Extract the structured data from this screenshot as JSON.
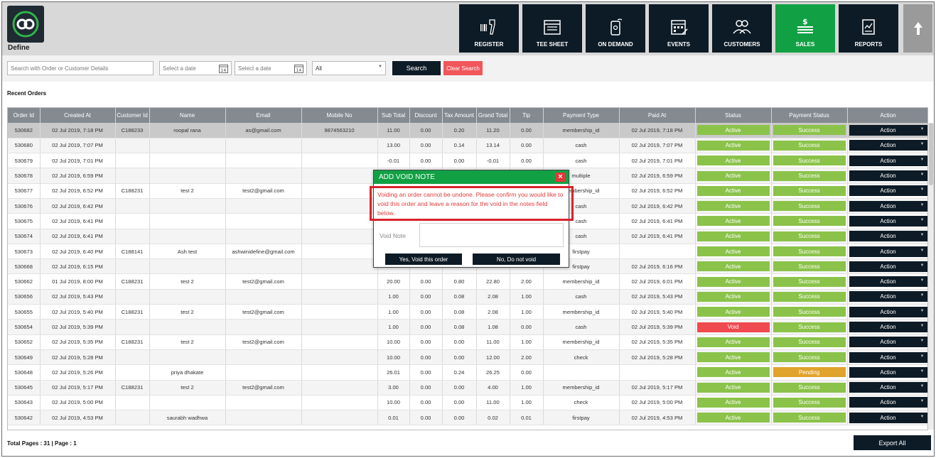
{
  "logo": {
    "text": "Define"
  },
  "nav": [
    {
      "label": "REGISTER",
      "icon": "barcode-scanner-icon"
    },
    {
      "label": "TEE SHEET",
      "icon": "calendar-list-icon"
    },
    {
      "label": "ON DEMAND",
      "icon": "mobile-phone-icon"
    },
    {
      "label": "EVENTS",
      "icon": "event-calendar-icon"
    },
    {
      "label": "CUSTOMERS",
      "icon": "people-icon"
    },
    {
      "label": "SALES",
      "icon": "money-icon"
    },
    {
      "label": "REPORTS",
      "icon": "report-icon"
    }
  ],
  "accent_green": "#11a144",
  "filters": {
    "search_placeholder": "Search with Order or Customer Details",
    "date_from_placeholder": "Select a date",
    "date_to_placeholder": "Select a date",
    "calendar_day": "14",
    "type_selected": "All",
    "search_label": "Search",
    "clear_label": "Clear Search"
  },
  "section_title": "Recent Orders",
  "table": {
    "columns": [
      "Order Id",
      "Created At",
      "Customer Id",
      "Name",
      "Email",
      "Mobile No",
      "Sub Total",
      "Discount",
      "Tax Amount",
      "Grand Total",
      "Tip",
      "Payment Type",
      "Paid At",
      "Status",
      "Payment Status",
      "Action"
    ],
    "rows": [
      [
        "530682",
        "02 Jul 2019, 7:18 PM",
        "C188233",
        "roopal rana",
        "as@gmail.com",
        "9874563210",
        "11.00",
        "0.00",
        "0.20",
        "11.20",
        "0.00",
        "membership_id",
        "02 Jul 2019, 7:18 PM",
        "Active",
        "Success",
        "Action"
      ],
      [
        "530680",
        "02 Jul 2019, 7:07 PM",
        "",
        "",
        "",
        "",
        "13.00",
        "0.00",
        "0.14",
        "13.14",
        "0.00",
        "cash",
        "02 Jul 2019, 7:07 PM",
        "Active",
        "Success",
        "Action"
      ],
      [
        "530679",
        "02 Jul 2019, 7:01 PM",
        "",
        "",
        "",
        "",
        "-0.01",
        "0.00",
        "0.00",
        "-0.01",
        "0.00",
        "cash",
        "02 Jul 2019, 7:01 PM",
        "Active",
        "Success",
        "Action"
      ],
      [
        "530678",
        "02 Jul 2019, 6:59 PM",
        "",
        "",
        "",
        "",
        "",
        "",
        "",
        "",
        "",
        "multiple",
        "02 Jul 2019, 6:59 PM",
        "Active",
        "Success",
        "Action"
      ],
      [
        "530677",
        "02 Jul 2019, 6:52 PM",
        "C188231",
        "test 2",
        "test2@gmail.com",
        "",
        "",
        "",
        "",
        "",
        "",
        "membership_id",
        "02 Jul 2019, 6:52 PM",
        "Active",
        "Success",
        "Action"
      ],
      [
        "530676",
        "02 Jul 2019, 6:42 PM",
        "",
        "",
        "",
        "",
        "",
        "",
        "",
        "",
        "",
        "cash",
        "02 Jul 2019, 6:42 PM",
        "Active",
        "Success",
        "Action"
      ],
      [
        "530675",
        "02 Jul 2019, 6:41 PM",
        "",
        "",
        "",
        "",
        "",
        "",
        "",
        "",
        "",
        "cash",
        "02 Jul 2019, 6:41 PM",
        "Active",
        "Success",
        "Action"
      ],
      [
        "530674",
        "02 Jul 2019, 6:41 PM",
        "",
        "",
        "",
        "",
        "",
        "",
        "",
        "",
        "",
        "cash",
        "02 Jul 2019, 6:41 PM",
        "Active",
        "Success",
        "Action"
      ],
      [
        "530673",
        "02 Jul 2019, 6:40 PM",
        "C188141",
        "Ash test",
        "ashwinidefine@gmail.com",
        "",
        "",
        "",
        "",
        "",
        "",
        "firstpay",
        "",
        "Active",
        "Success",
        "Action"
      ],
      [
        "530668",
        "02 Jul 2019, 6:15 PM",
        "",
        "",
        "",
        "",
        "",
        "",
        "",
        "",
        "",
        "firstpay",
        "02 Jul 2019, 6:16 PM",
        "Active",
        "Success",
        "Action"
      ],
      [
        "530662",
        "01 Jul 2019, 8:00 PM",
        "C188231",
        "test 2",
        "test2@gmail.com",
        "",
        "20.00",
        "0.00",
        "0.80",
        "22.80",
        "2.00",
        "membership_id",
        "02 Jul 2019, 6:01 PM",
        "Active",
        "Success",
        "Action"
      ],
      [
        "530656",
        "02 Jul 2019, 5:43 PM",
        "",
        "",
        "",
        "",
        "1.00",
        "0.00",
        "0.08",
        "2.08",
        "1.00",
        "cash",
        "02 Jul 2019, 5:43 PM",
        "Active",
        "Success",
        "Action"
      ],
      [
        "530655",
        "02 Jul 2019, 5:40 PM",
        "C188231",
        "test 2",
        "test2@gmail.com",
        "",
        "1.00",
        "0.00",
        "0.08",
        "2.08",
        "1.00",
        "membership_id",
        "02 Jul 2019, 5:40 PM",
        "Active",
        "Success",
        "Action"
      ],
      [
        "530654",
        "02 Jul 2019, 5:39 PM",
        "",
        "",
        "",
        "",
        "1.00",
        "0.00",
        "0.08",
        "1.08",
        "0.00",
        "cash",
        "02 Jul 2019, 5:39 PM",
        "Void",
        "Success",
        "Action"
      ],
      [
        "530652",
        "02 Jul 2019, 5:35 PM",
        "C188231",
        "test 2",
        "test2@gmail.com",
        "",
        "10.00",
        "0.00",
        "0.00",
        "11.00",
        "1.00",
        "membership_id",
        "02 Jul 2019, 5:35 PM",
        "Active",
        "Success",
        "Action"
      ],
      [
        "530649",
        "02 Jul 2019, 5:28 PM",
        "",
        "",
        "",
        "",
        "10.00",
        "0.00",
        "0.00",
        "12.00",
        "2.00",
        "check",
        "02 Jul 2019, 5:28 PM",
        "Active",
        "Success",
        "Action"
      ],
      [
        "530648",
        "02 Jul 2019, 5:26 PM",
        "",
        "priya dhakate",
        "",
        "",
        "26.01",
        "0.00",
        "0.24",
        "26.25",
        "0.00",
        "",
        "",
        "Active",
        "Pending",
        "Action"
      ],
      [
        "530645",
        "02 Jul 2019, 5:17 PM",
        "C188231",
        "test 2",
        "test2@gmail.com",
        "",
        "3.00",
        "0.00",
        "0.00",
        "4.00",
        "1.00",
        "membership_id",
        "02 Jul 2019, 5:17 PM",
        "Active",
        "Success",
        "Action"
      ],
      [
        "530643",
        "02 Jul 2019, 5:00 PM",
        "",
        "",
        "",
        "",
        "10.00",
        "0.00",
        "0.00",
        "11.00",
        "1.00",
        "check",
        "02 Jul 2019, 5:00 PM",
        "Active",
        "Success",
        "Action"
      ],
      [
        "530642",
        "02 Jul 2019, 4:53 PM",
        "",
        "saurabh wadhwa",
        "",
        "",
        "0.01",
        "0.00",
        "0.00",
        "0.02",
        "0.01",
        "firstpay",
        "02 Jul 2019, 4:53 PM",
        "Active",
        "Success",
        "Action"
      ]
    ]
  },
  "footer": {
    "pages_text": "Total Pages : 31 | Page : 1",
    "export_label": "Export All"
  },
  "modal": {
    "title": "ADD VOID NOTE",
    "close": "×",
    "warning": "Voiding an order cannot be undone. Please confirm you would like to void this order and leave a reason for the void in the notes field below.",
    "note_label": "Void Note",
    "confirm_label": "Yes, Void this order",
    "cancel_label": "No, Do not void"
  }
}
